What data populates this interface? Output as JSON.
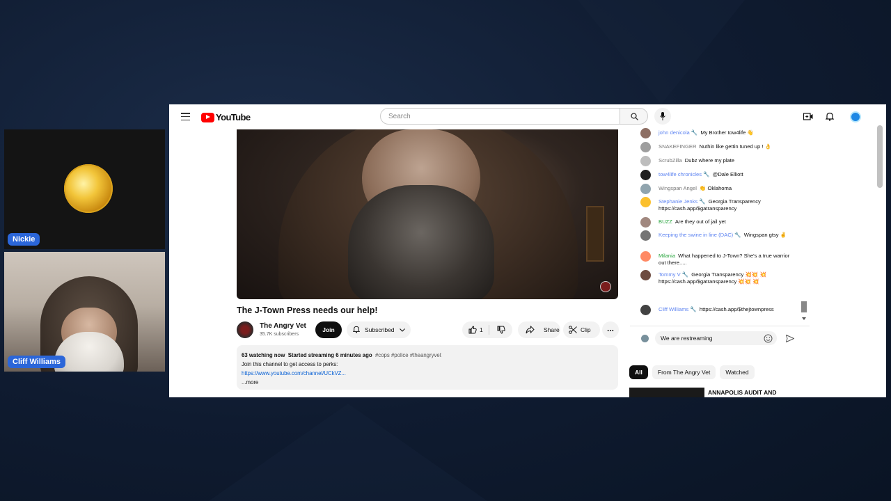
{
  "webcams": {
    "top_name": "Nickie",
    "bottom_name": "Cliff Williams"
  },
  "youtube": {
    "logo_text": "YouTube",
    "search_placeholder": "Search",
    "video_title": "The J-Town Press needs our help!",
    "channel": {
      "name": "The Angry Vet",
      "subscribers": "35.7K subscribers"
    },
    "buttons": {
      "join": "Join",
      "subscribed": "Subscribed",
      "like_count": "1",
      "share": "Share",
      "clip": "Clip",
      "more": "..."
    },
    "description": {
      "watching": "63 watching now",
      "started": "Started streaming 6 minutes ago",
      "tags": "#cops #police #theangryvet",
      "line1": "Join this channel to get access to perks:",
      "link": "https://www.youtube.com/channel/UCkVZ...",
      "more": "...more"
    },
    "chat": {
      "messages": [
        {
          "author": "john denicola 🔧",
          "text": "My Brother tow4life 👋",
          "style": "blue",
          "avatar_color": "#8d6e63"
        },
        {
          "author": "SNAKEFINGER",
          "text": "Nuthin like gettin tuned up ! 👌",
          "style": "gray",
          "avatar_color": "#9e9e9e"
        },
        {
          "author": "ScrubZilla",
          "text": "Dubz where my plate",
          "style": "gray",
          "avatar_color": "#bdbdbd"
        },
        {
          "author": "tow4life chronicles 🔧",
          "text": "@Dale Elliott",
          "style": "blue",
          "avatar_color": "#212121"
        },
        {
          "author": "Wingspan Angel",
          "text": "👏 Oklahoma",
          "style": "gray",
          "avatar_color": "#90a4ae"
        },
        {
          "author": "Stephanie Jenks 🔧",
          "text": "Georgia Transparency https://cash.app/$gatransparency",
          "style": "blue",
          "avatar_color": "#fbc02d"
        },
        {
          "author": "BUZZ",
          "text": "Are they out of jail yet",
          "style": "green",
          "avatar_color": "#a1887f"
        },
        {
          "author": "Keeping the swine in line (DAC) 🔧",
          "text": "Wingspan gtsy ✌",
          "style": "blue",
          "avatar_color": "#757575"
        },
        {
          "author": "Milania",
          "text": "What happened to J-Town? She's a true warrior out there.....",
          "style": "green",
          "avatar_color": "#ff8a65"
        },
        {
          "author": "Tommy V 🔧",
          "text": "Georgia Transparency 💥💥 💥 https://cash.app/$gatransparency 💥💥 💥",
          "style": "blue",
          "avatar_color": "#6d4c41"
        },
        {
          "author": "Cliff Williams 🔧",
          "text": "https://cash.app/$thejtownpress",
          "style": "blue",
          "avatar_color": "#424242"
        }
      ],
      "input_value": "We are restreaming"
    },
    "filters": [
      "All",
      "From The Angry Vet",
      "Watched"
    ],
    "recommendation_title": "ANNAPOLIS AUDIT AND"
  },
  "colors": {
    "brand_red": "#ff0000",
    "link_blue": "#065fd4",
    "name_tag": "#2b66d9"
  }
}
